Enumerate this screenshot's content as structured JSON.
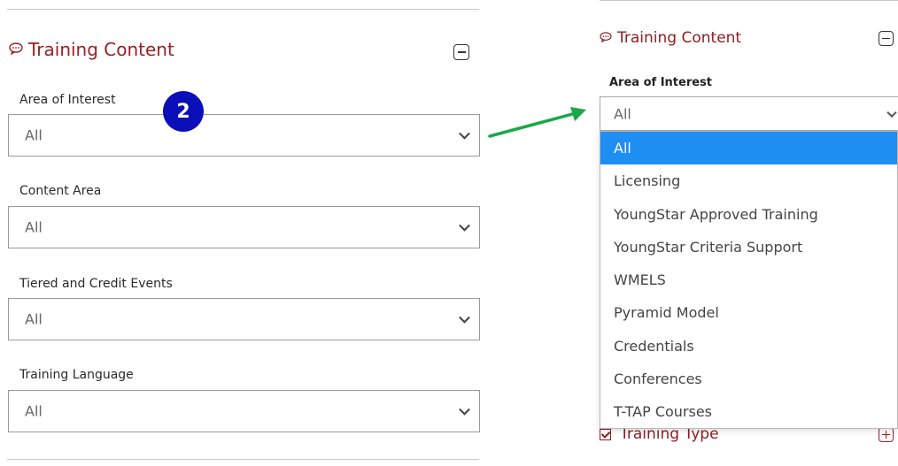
{
  "left_panel": {
    "section_title": "Training Content",
    "badge": "2",
    "fields": [
      {
        "label": "Area of Interest",
        "value": "All"
      },
      {
        "label": "Content Area",
        "value": "All"
      },
      {
        "label": "Tiered and Credit Events",
        "value": "All"
      },
      {
        "label": "Training Language",
        "value": "All"
      }
    ]
  },
  "right_panel": {
    "section_title": "Training Content",
    "field_label": "Area of Interest",
    "selected_value": "All",
    "options": [
      "All",
      "Licensing",
      "YoungStar Approved Training",
      "YoungStar Criteria Support",
      "WMELS",
      "Pyramid Model",
      "Credentials",
      "Conferences",
      "T-TAP Courses"
    ],
    "next_section_title": "Training Type"
  },
  "colors": {
    "title_red": "#9b2024",
    "selected_option_bg": "#1e8ef2",
    "arrow_green": "#1aa84a",
    "badge_blue": "#0b0fb8"
  }
}
